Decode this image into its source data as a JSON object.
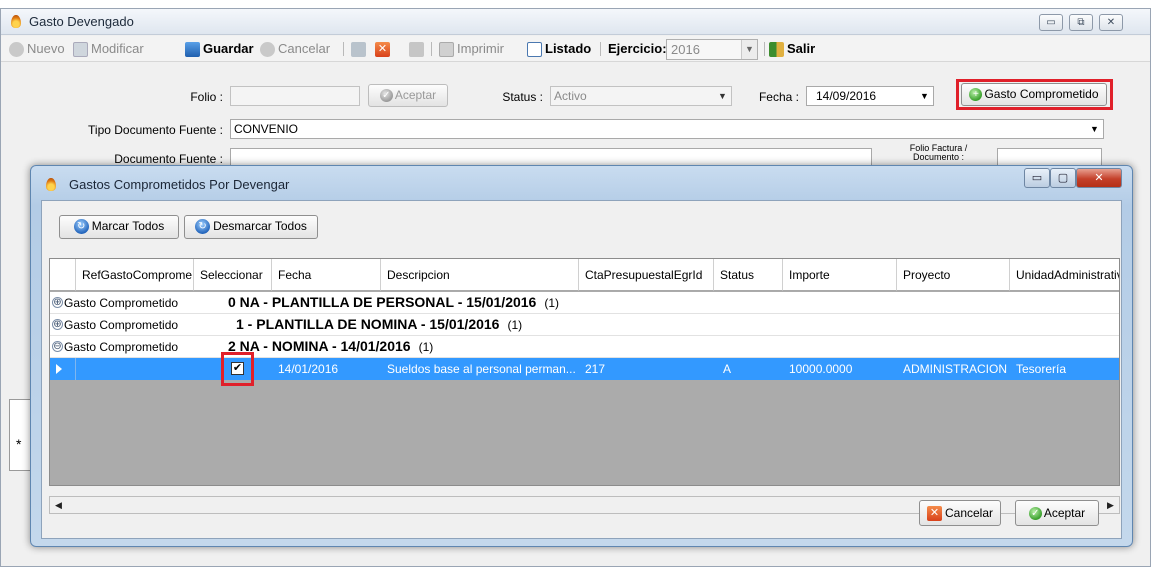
{
  "main_window": {
    "title": "Gasto Devengado",
    "controls": [
      "▭",
      "⧉",
      "✕"
    ]
  },
  "toolbar": {
    "nuevo": "Nuevo",
    "modificar": "Modificar",
    "guardar": "Guardar",
    "cancelar": "Cancelar",
    "imprimir": "Imprimir",
    "listado": "Listado",
    "ejercicio_label": "Ejercicio:",
    "ejercicio_value": "2016",
    "salir": "Salir"
  },
  "form": {
    "folio_label": "Folio :",
    "folio_value": "",
    "aceptar_label": "Aceptar",
    "status_label": "Status :",
    "status_value": "Activo",
    "fecha_label": "Fecha :",
    "fecha_value": "14/09/2016",
    "gasto_comprometido_label": "Gasto Comprometido",
    "tipo_doc_label": "Tipo Documento Fuente :",
    "tipo_doc_value": "CONVENIO",
    "doc_fuente_label": "Documento Fuente :",
    "doc_fuente_value": "",
    "folio_factura_label_1": "Folio Factura /",
    "folio_factura_label_2": "Documento :",
    "folio_factura_value": ""
  },
  "background_grid": {
    "new_row_marker": "*"
  },
  "dialog": {
    "title": "Gastos Comprometidos Por Devengar",
    "marcar_todos": "Marcar Todos",
    "desmarcar_todos": "Desmarcar Todos",
    "columns": [
      "RefGastoComprome",
      "Seleccionar",
      "Fecha",
      "Descripcion",
      "CtaPresupuestalEgrId",
      "Status",
      "Importe",
      "Proyecto",
      "UnidadAdministrativ"
    ],
    "groups": [
      {
        "toggle": "⊕",
        "name": "Gasto Comprometido",
        "value": "0 NA - PLANTILLA DE PERSONAL - 15/01/2016",
        "count": "(1)"
      },
      {
        "toggle": "⊕",
        "name": "Gasto Comprometido",
        "value": "1 - PLANTILLA DE NOMINA - 15/01/2016",
        "count": "(1)"
      },
      {
        "toggle": "⊖",
        "name": "Gasto Comprometido",
        "value": "2 NA - NOMINA - 14/01/2016",
        "count": "(1)"
      }
    ],
    "selected_row": {
      "seleccionar": "✔",
      "fecha": "14/01/2016",
      "descripcion": "Sueldos base al personal perman...",
      "cta": "217",
      "status": "A",
      "importe": "10000.0000",
      "proyecto": "ADMINISTRACION",
      "unidad": "Tesorería"
    },
    "cancelar": "Cancelar",
    "aceptar": "Aceptar"
  },
  "colors": {
    "selection": "#3399ff",
    "highlight_red": "#e0202a",
    "dialog_frame": "#b3cce6"
  }
}
